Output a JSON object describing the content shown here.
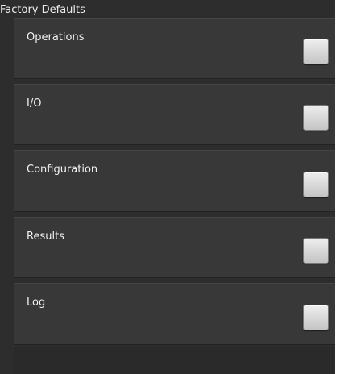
{
  "dialog": {
    "title": "Factory Defaults"
  },
  "options": [
    {
      "label": "Operations",
      "checked": false
    },
    {
      "label": "I/O",
      "checked": false
    },
    {
      "label": "Configuration",
      "checked": false
    },
    {
      "label": "Results",
      "checked": false
    },
    {
      "label": "Log",
      "checked": false
    }
  ]
}
